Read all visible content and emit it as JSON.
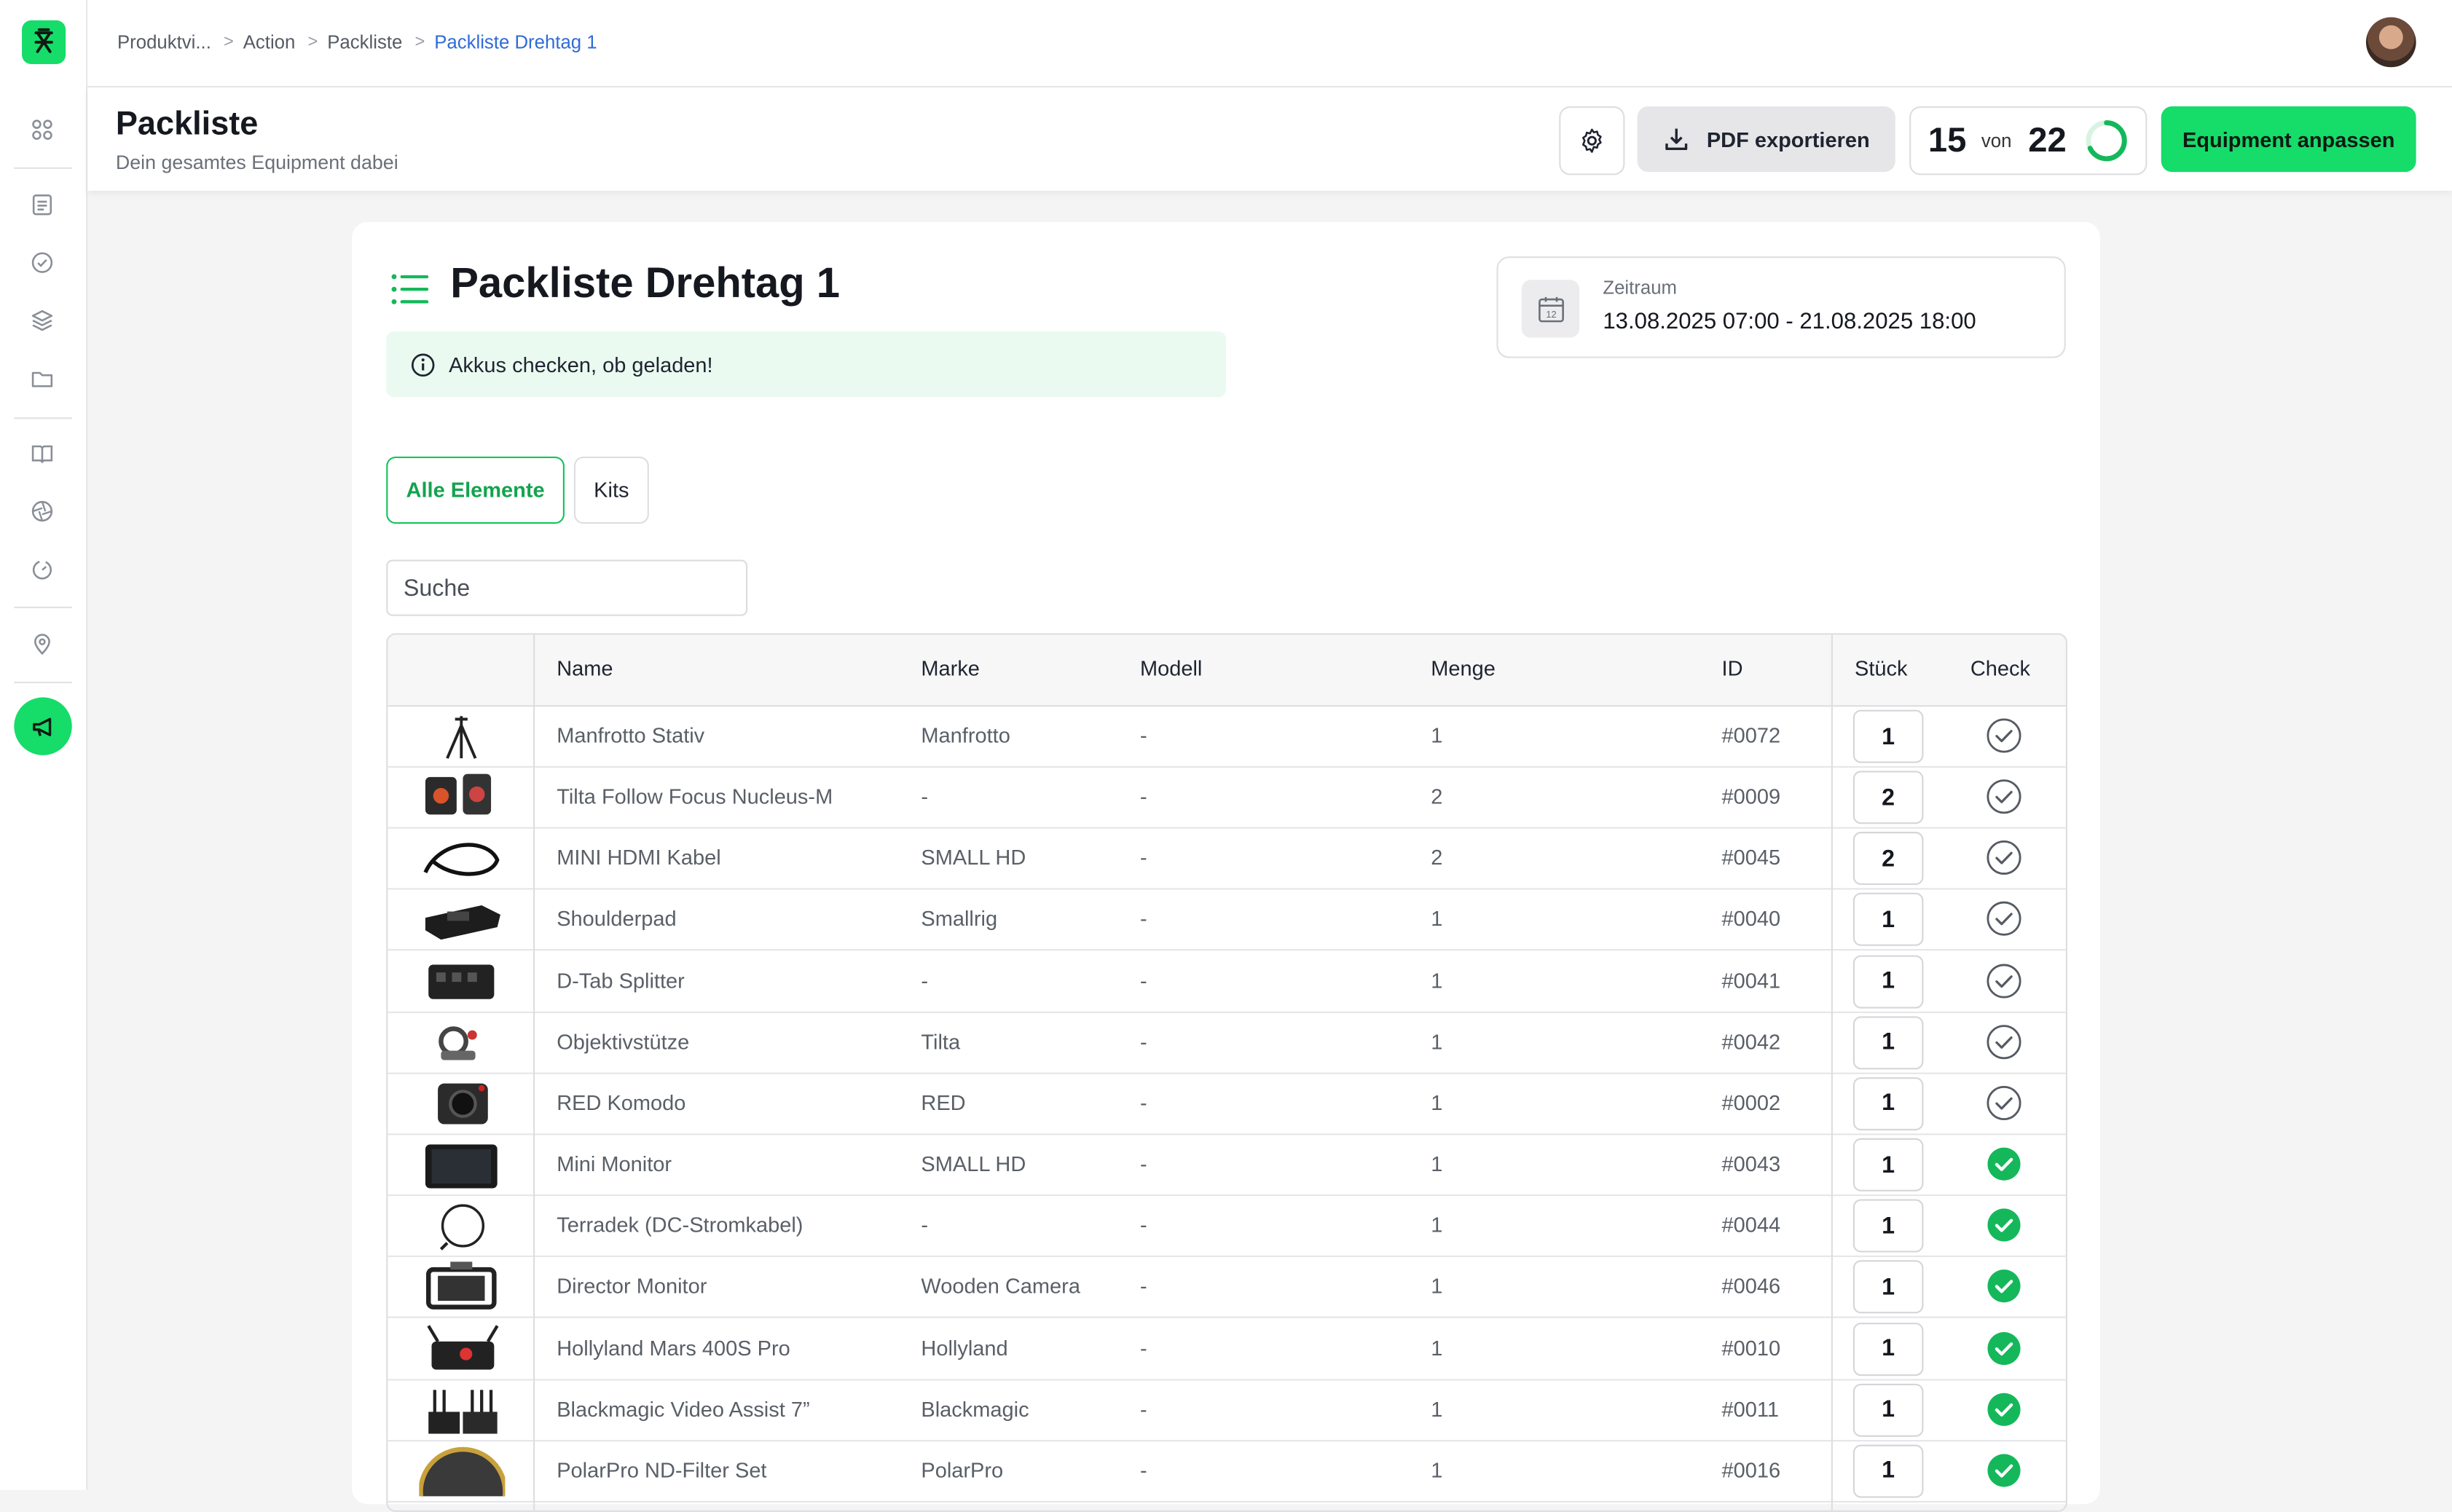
{
  "breadcrumb": [
    "Produktvi...",
    "Action",
    "Packliste",
    "Packliste Drehtag 1"
  ],
  "header": {
    "title": "Packliste",
    "subtitle": "Dein gesamtes Equipment dabei",
    "pdf_label": "PDF exportieren",
    "count_done": "15",
    "count_von": "von",
    "count_total": "22",
    "progress": 0.68,
    "equip_label": "Equipment anpassen"
  },
  "card": {
    "title": "Packliste Drehtag 1",
    "note": "Akkus checken, ob geladen!",
    "range_label": "Zeitraum",
    "range_value": "13.08.2025 07:00  -  21.08.2025 18:00",
    "tab_all": "Alle Elemente",
    "tab_kits": "Kits",
    "search_placeholder": "Suche"
  },
  "table": {
    "columns": [
      "Name",
      "Marke",
      "Modell",
      "Menge",
      "ID",
      "Stück",
      "Check"
    ],
    "rows": [
      {
        "name": "Manfrotto Stativ",
        "brand": "Manfrotto",
        "model": "-",
        "amount": "1",
        "id": "#0072",
        "qty": "1",
        "checked": false,
        "icon": "tripod-icon"
      },
      {
        "name": "Tilta Follow Focus Nucleus-M",
        "brand": "-",
        "model": "-",
        "amount": "2",
        "id": "#0009",
        "qty": "2",
        "checked": false,
        "icon": "follow-focus-icon"
      },
      {
        "name": "MINI HDMI Kabel",
        "brand": "SMALL HD",
        "model": "-",
        "amount": "2",
        "id": "#0045",
        "qty": "2",
        "checked": false,
        "icon": "cable-icon"
      },
      {
        "name": "Shoulderpad",
        "brand": "Smallrig",
        "model": "-",
        "amount": "1",
        "id": "#0040",
        "qty": "1",
        "checked": false,
        "icon": "shoulderpad-icon"
      },
      {
        "name": "D-Tab Splitter",
        "brand": "-",
        "model": "-",
        "amount": "1",
        "id": "#0041",
        "qty": "1",
        "checked": false,
        "icon": "splitter-icon"
      },
      {
        "name": "Objektivstütze",
        "brand": "Tilta",
        "model": "-",
        "amount": "1",
        "id": "#0042",
        "qty": "1",
        "checked": false,
        "icon": "lens-support-icon"
      },
      {
        "name": "RED Komodo",
        "brand": "RED",
        "model": "-",
        "amount": "1",
        "id": "#0002",
        "qty": "1",
        "checked": false,
        "icon": "camera-icon"
      },
      {
        "name": "Mini Monitor",
        "brand": "SMALL HD",
        "model": "-",
        "amount": "1",
        "id": "#0043",
        "qty": "1",
        "checked": true,
        "icon": "monitor-icon"
      },
      {
        "name": "Terradek (DC-Stromkabel)",
        "brand": "-",
        "model": "-",
        "amount": "1",
        "id": "#0044",
        "qty": "1",
        "checked": true,
        "icon": "coil-cable-icon"
      },
      {
        "name": "Director Monitor",
        "brand": "Wooden Camera",
        "model": "-",
        "amount": "1",
        "id": "#0046",
        "qty": "1",
        "checked": true,
        "icon": "director-monitor-icon"
      },
      {
        "name": "Hollyland Mars 400S Pro",
        "brand": "Hollyland",
        "model": "-",
        "amount": "1",
        "id": "#0010",
        "qty": "1",
        "checked": true,
        "icon": "transmitter-icon"
      },
      {
        "name": "Blackmagic Video Assist 7”",
        "brand": "Blackmagic",
        "model": "-",
        "amount": "1",
        "id": "#0011",
        "qty": "1",
        "checked": true,
        "icon": "video-assist-icon"
      },
      {
        "name": "PolarPro ND-Filter Set",
        "brand": "PolarPro",
        "model": "-",
        "amount": "1",
        "id": "#0016",
        "qty": "1",
        "checked": true,
        "icon": "nd-filter-icon"
      }
    ]
  },
  "colors": {
    "accent": "#16dc6a",
    "check_done": "#14b85a",
    "link": "#2f6bd8"
  }
}
